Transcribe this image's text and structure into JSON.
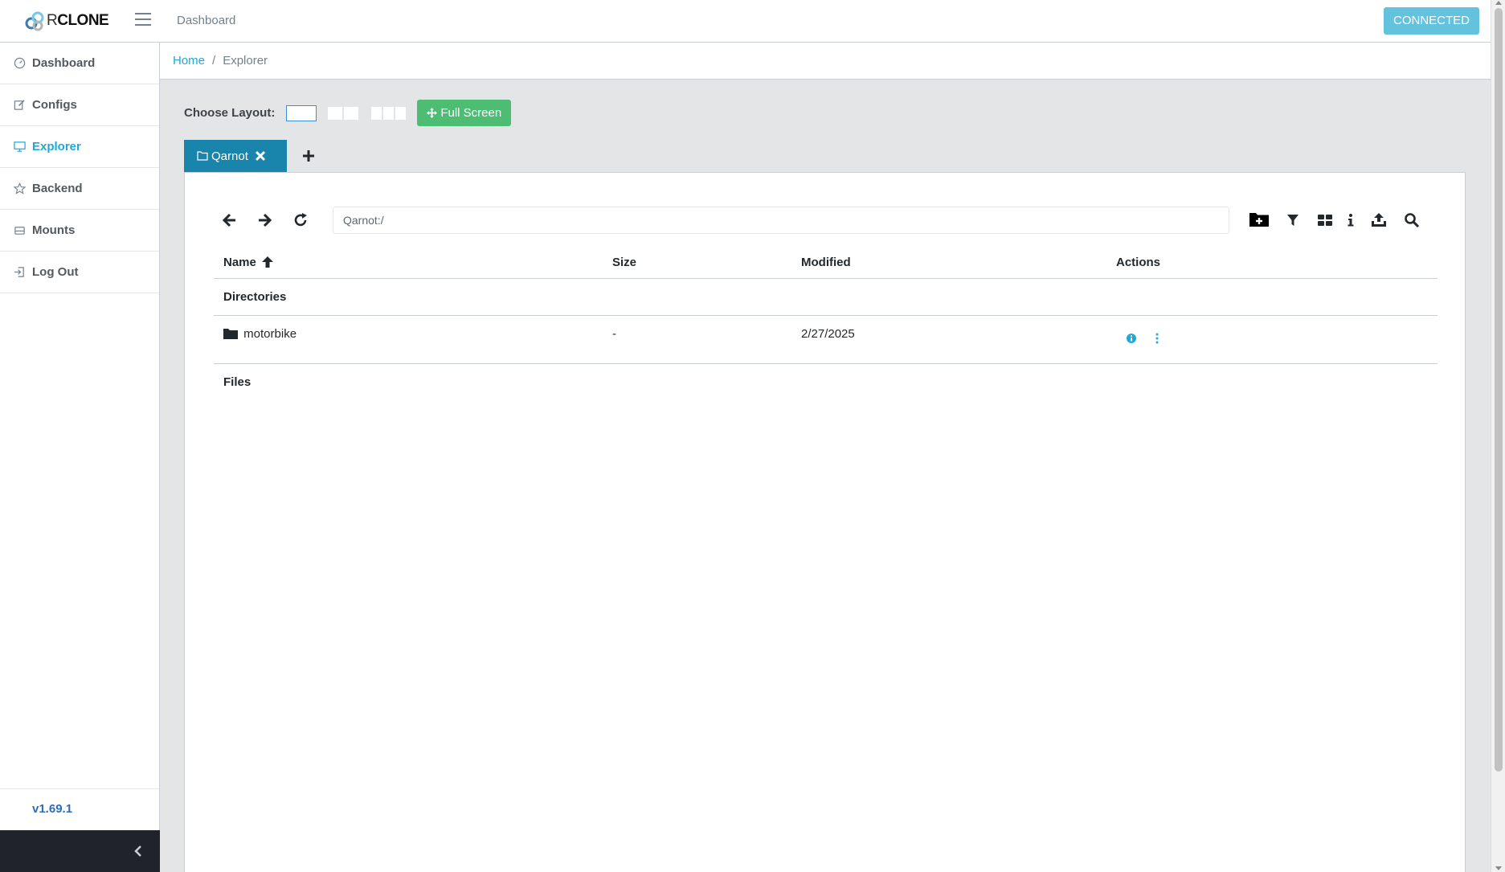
{
  "header": {
    "logo_prefix": "R",
    "logo_text": "CLONE",
    "menu_link": "Dashboard",
    "status_button": "CONNECTED"
  },
  "sidebar": {
    "items": [
      {
        "label": "Dashboard",
        "icon": "speedometer-icon",
        "active": false
      },
      {
        "label": "Configs",
        "icon": "edit-icon",
        "active": false
      },
      {
        "label": "Explorer",
        "icon": "monitor-icon",
        "active": true
      },
      {
        "label": "Backend",
        "icon": "star-icon",
        "active": false
      },
      {
        "label": "Mounts",
        "icon": "drive-icon",
        "active": false
      },
      {
        "label": "Log Out",
        "icon": "logout-icon",
        "active": false
      }
    ],
    "version": "v1.69.1"
  },
  "breadcrumb": {
    "home": "Home",
    "separator": "/",
    "current": "Explorer"
  },
  "layout": {
    "label": "Choose Layout:",
    "options": [
      1,
      2,
      3
    ],
    "selected": 1,
    "fullscreen_label": "Full Screen"
  },
  "tabs": [
    {
      "label": "Qarnot"
    }
  ],
  "explorer": {
    "path": "Qarnot:/",
    "columns": {
      "name": "Name",
      "size": "Size",
      "modified": "Modified",
      "actions": "Actions"
    },
    "directories_label": "Directories",
    "files_label": "Files",
    "directories": [
      {
        "name": "motorbike",
        "size": "-",
        "modified": "2/27/2025"
      }
    ]
  },
  "colors": {
    "accent": "#20a8d8",
    "tab": "#1985ac",
    "connected": "#63c2de",
    "success": "#4dbd74",
    "sidebar_footer": "#20232a"
  }
}
